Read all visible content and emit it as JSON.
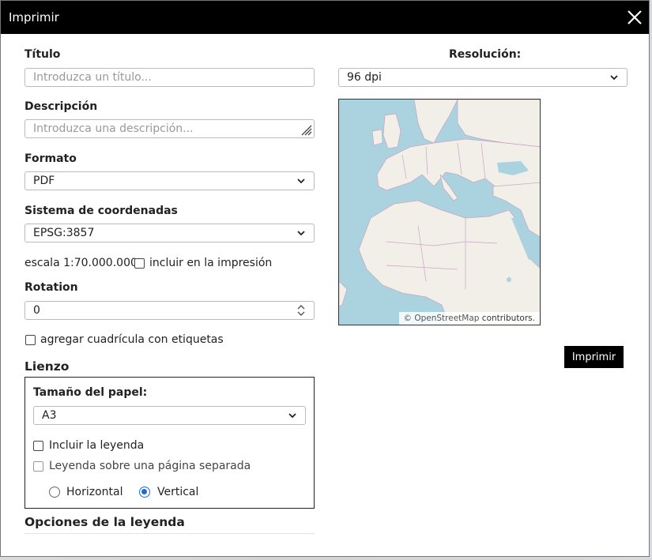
{
  "dialog": {
    "title": "Imprimir"
  },
  "form": {
    "title_label": "Título",
    "title_placeholder": "Introduzca un título...",
    "description_label": "Descripción",
    "description_placeholder": "Introduzca una descripción...",
    "format_label": "Formato",
    "format_value": "PDF",
    "crs_label": "Sistema de coordenadas",
    "crs_value": "EPSG:3857",
    "scale_text": "escala 1:70.000.000",
    "scale_include_label": "incluir en la impresión",
    "rotation_label": "Rotation",
    "rotation_value": "0",
    "grid_label": "agregar cuadrícula con etiquetas",
    "resolution_label": "Resolución:",
    "resolution_value": "96 dpi",
    "print_button": "Imprimir"
  },
  "map": {
    "attribution_link": "© OpenStreetMap",
    "attribution_rest": "contributors."
  },
  "canvas": {
    "section_title": "Lienzo",
    "paper_size_label": "Tamaño del papel:",
    "paper_size_value": "A3",
    "include_legend_label": "Incluir la leyenda",
    "legend_separate_label": "Leyenda sobre una página separada",
    "orientation_horizontal": "Horizontal",
    "orientation_vertical": "Vertical",
    "orientation_selected": "Vertical"
  },
  "legend_options": {
    "section_title": "Opciones de la leyenda"
  },
  "colors": {
    "accent": "#1a6cd8",
    "titlebar": "#000000",
    "sea": "#aad3df",
    "land": "#f2efe9",
    "border": "#c9a3c2"
  }
}
